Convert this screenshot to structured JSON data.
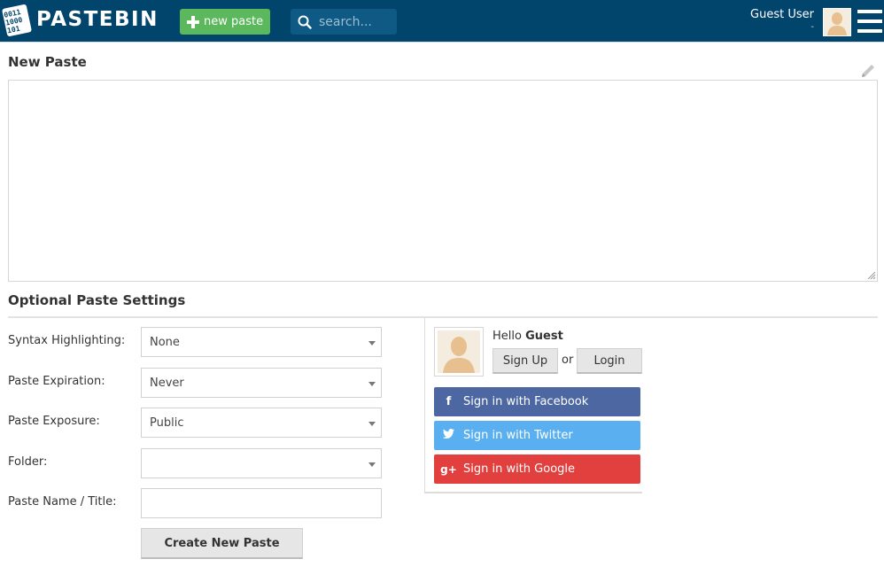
{
  "header": {
    "logo_text": "PASTEBIN",
    "logo_icon_digits": [
      "0011",
      "1000",
      "101"
    ],
    "new_paste_label": "new paste",
    "search_placeholder": "search...",
    "user_name": "Guest User",
    "user_sub": "-",
    "colors": {
      "bar": "#02456c",
      "new_paste": "#5cb85c",
      "search": "#0e5a85"
    }
  },
  "main": {
    "title": "New Paste",
    "paste_content": ""
  },
  "settings": {
    "title": "Optional Paste Settings",
    "fields": [
      {
        "label": "Syntax Highlighting:",
        "value": "None",
        "type": "select"
      },
      {
        "label": "Paste Expiration:",
        "value": "Never",
        "type": "select"
      },
      {
        "label": "Paste Exposure:",
        "value": "Public",
        "type": "select"
      },
      {
        "label": "Folder:",
        "value": "",
        "type": "select"
      },
      {
        "label": "Paste Name / Title:",
        "value": "",
        "type": "text"
      }
    ],
    "submit_label": "Create New Paste"
  },
  "login_panel": {
    "hello": "Hello",
    "guest": "Guest",
    "signup_label": "Sign Up",
    "or_label": "or",
    "login_label": "Login",
    "social": [
      {
        "label": "Sign in with Facebook",
        "icon": "f",
        "color": "#4c67a1"
      },
      {
        "label": "Sign in with Twitter",
        "icon": "twitter-bird",
        "color": "#5aaff0"
      },
      {
        "label": "Sign in with Google",
        "icon": "g+",
        "color": "#e2403f"
      }
    ]
  }
}
